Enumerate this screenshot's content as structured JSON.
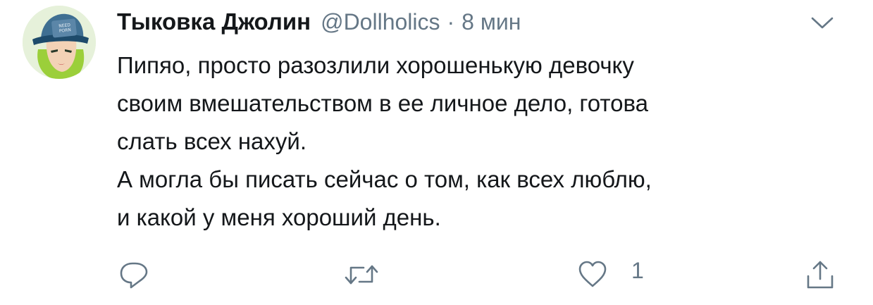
{
  "tweet": {
    "display_name": "Тыковка Джолин",
    "handle": "@Dollholics",
    "separator": "·",
    "time": "8 мин",
    "avatar_icon": "user-avatar-icon",
    "avatar_text": "NEED PORN",
    "text_lines": [
      "Пипяо, просто разозлили хорошенькую девочку",
      "своим вмешательством в ее личное дело, готова",
      "слать всех нахуй.",
      "А могла бы писать сейчас о том, как всех люблю,",
      "и какой у меня хороший день."
    ]
  },
  "actions": {
    "reply_icon": "reply-icon",
    "retweet_icon": "retweet-icon",
    "like_icon": "heart-icon",
    "like_count": "1",
    "share_icon": "share-icon"
  },
  "colors": {
    "text": "#14171a",
    "secondary": "#657786",
    "background": "#ffffff"
  }
}
